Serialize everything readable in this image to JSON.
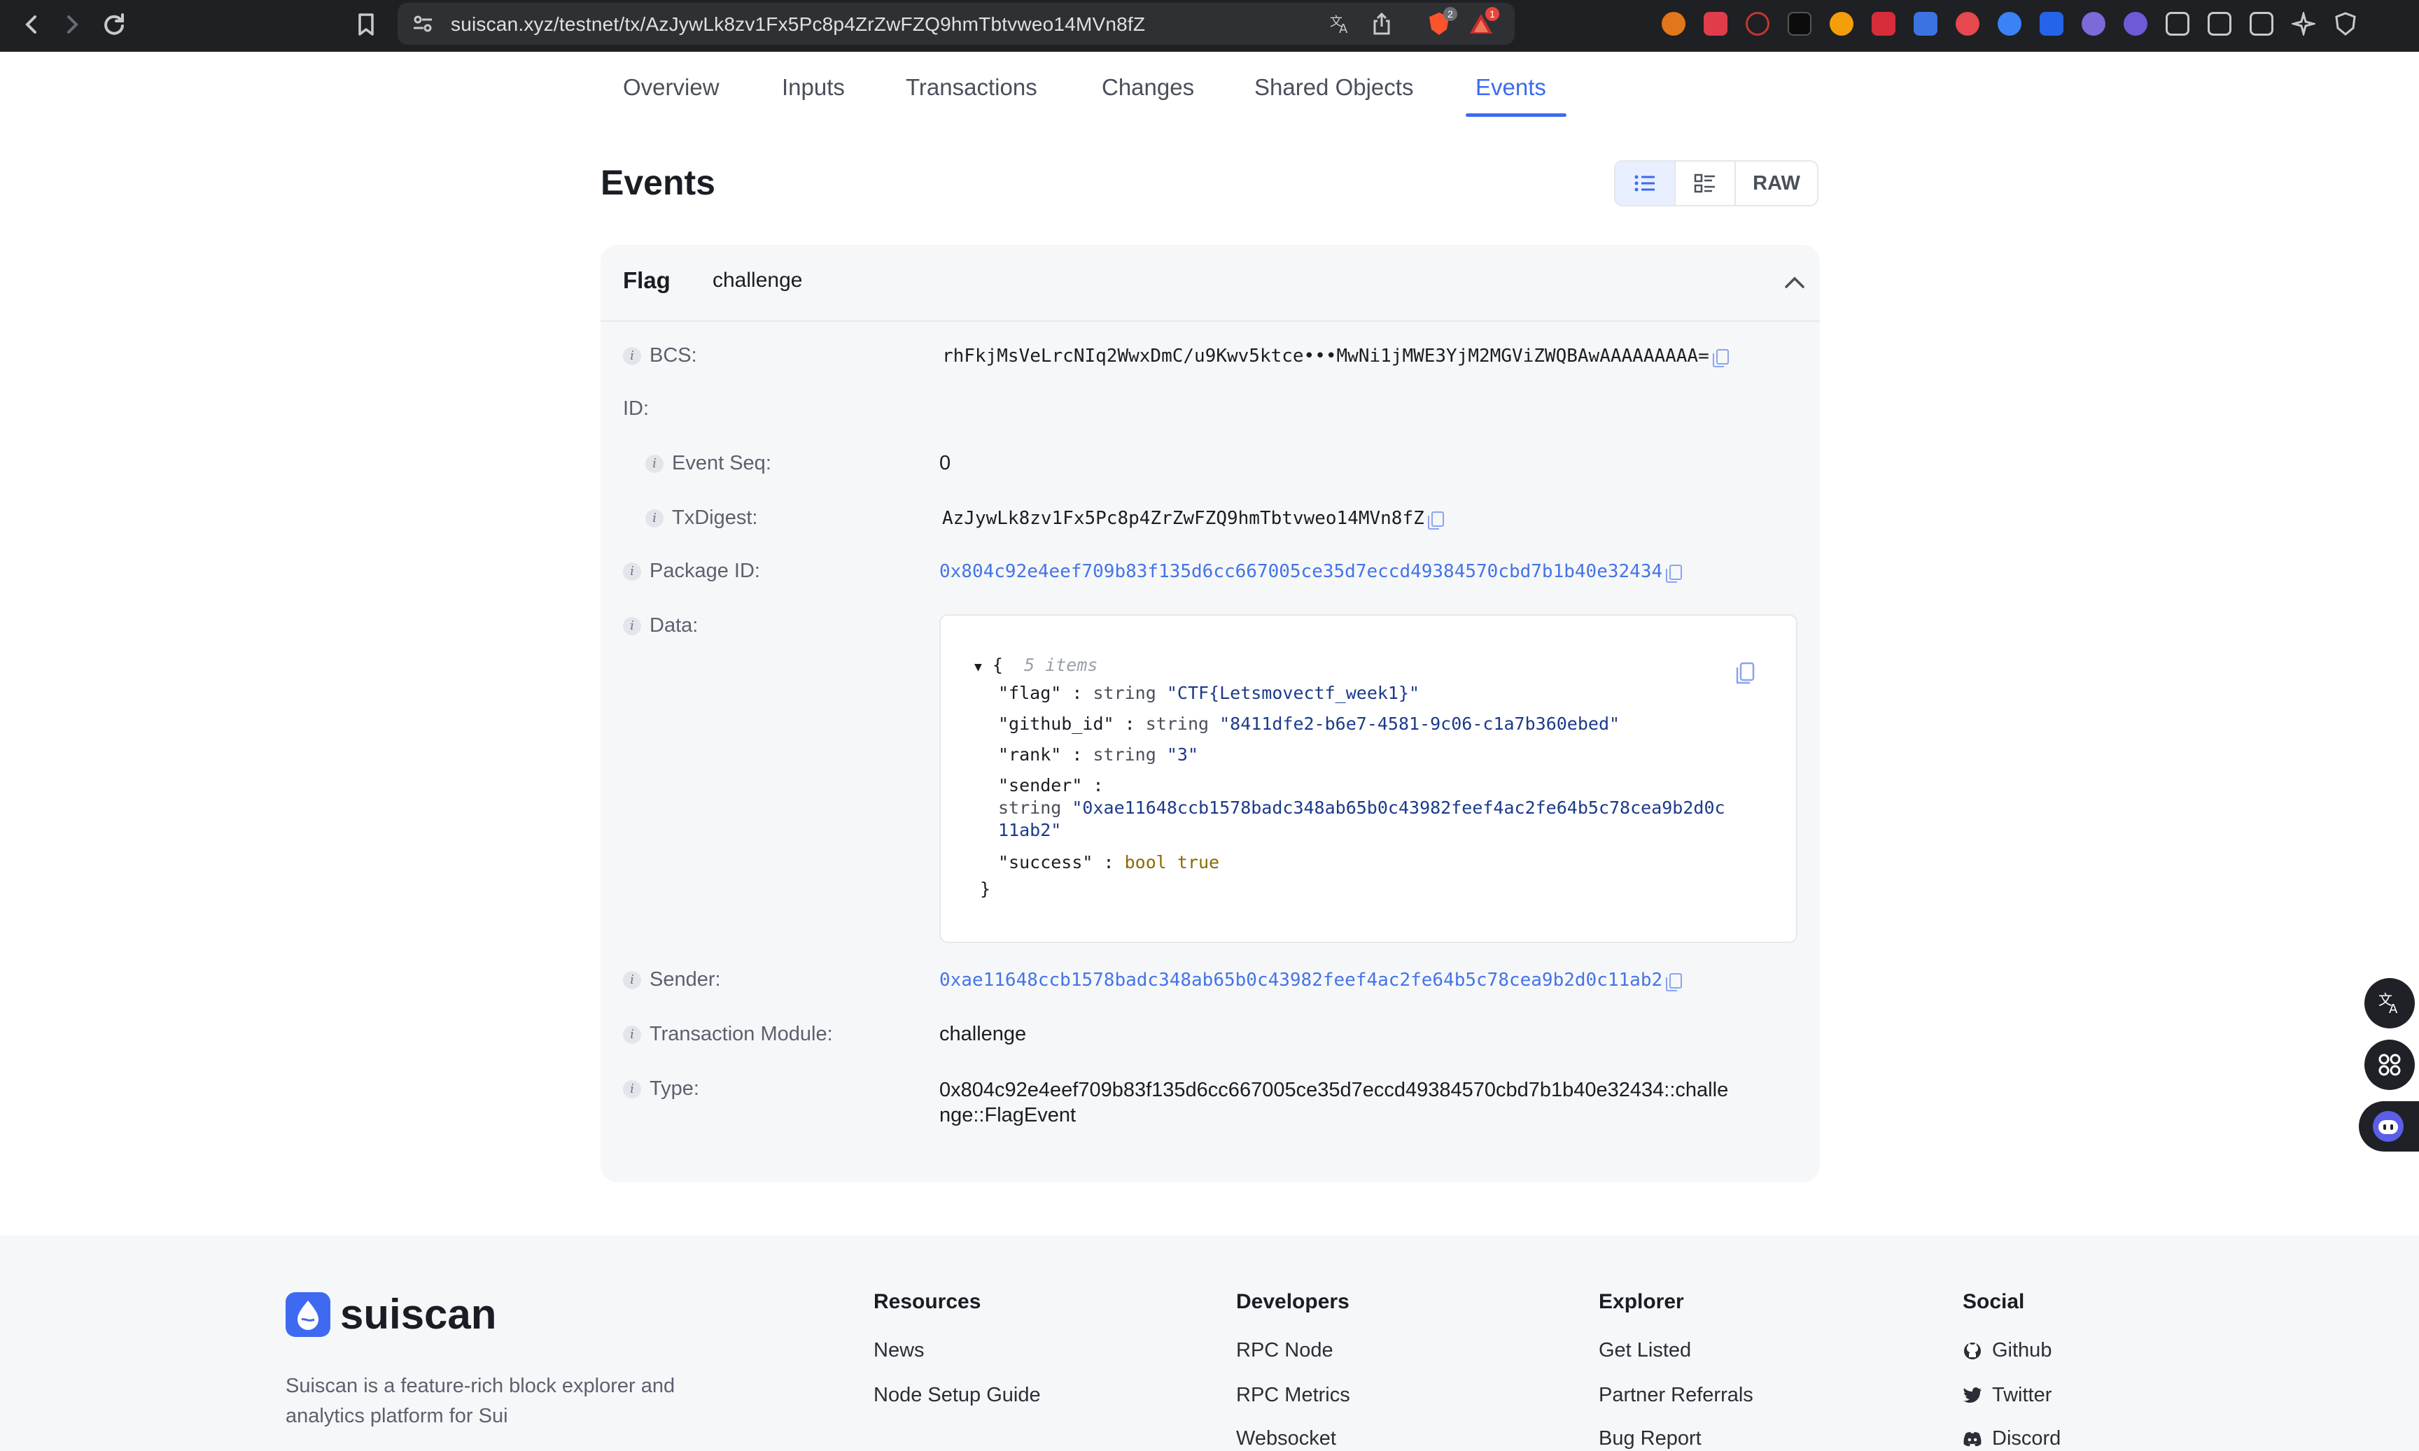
{
  "browser": {
    "url": "suiscan.xyz/testnet/tx/AzJywLk8zv1Fx5Pc8p4ZrZwFZQ9hmTbtvweo14MVn8fZ",
    "brave_badge": "2",
    "alert_badge": "1"
  },
  "tabs": [
    {
      "label": "Overview"
    },
    {
      "label": "Inputs"
    },
    {
      "label": "Transactions"
    },
    {
      "label": "Changes"
    },
    {
      "label": "Shared Objects"
    },
    {
      "label": "Events"
    }
  ],
  "active_tab": "Events",
  "page": {
    "title": "Events",
    "view_raw_label": "RAW"
  },
  "event": {
    "name": "Flag",
    "module": "challenge",
    "fields": {
      "bcs_label": "BCS:",
      "bcs_value": "rhFkjMsVeLrcNIq2WwxDmC/u9Kwv5ktce•••MwNi1jMWE3YjM2MGViZWQBAwAAAAAAAAA=",
      "id_label": "ID:",
      "event_seq_label": "Event Seq:",
      "event_seq_value": "0",
      "tx_digest_label": "TxDigest:",
      "tx_digest_value": "AzJywLk8zv1Fx5Pc8p4ZrZwFZQ9hmTbtvweo14MVn8fZ",
      "package_id_label": "Package ID:",
      "package_id_value": "0x804c92e4eef709b83f135d6cc667005ce35d7eccd49384570cbd7b1b40e32434",
      "data_label": "Data:",
      "sender_label": "Sender:",
      "sender_value": "0xae11648ccb1578badc348ab65b0c43982feef4ac2fe64b5c78cea9b2d0c11ab2",
      "tx_module_label": "Transaction Module:",
      "tx_module_value": "challenge",
      "type_label": "Type:",
      "type_value_line1": "0x804c92e4eef709b83f135d6cc667005ce35d7eccd49384570cbd7b1b40e32434::challe",
      "type_value_line2": "nge::FlagEvent"
    },
    "data_json": {
      "open": "{",
      "count": "5 items",
      "close": "}",
      "flag_key": "\"flag\"",
      "flag_type": "string",
      "flag_val": "\"CTF{Letsmovectf_week1}\"",
      "github_key": "\"github_id\"",
      "github_type": "string",
      "github_val": "\"8411dfe2-b6e7-4581-9c06-c1a7b360ebed\"",
      "rank_key": "\"rank\"",
      "rank_type": "string",
      "rank_val": "\"3\"",
      "sender_key": "\"sender\"",
      "sender_type": "string",
      "sender_val_line1": "\"0xae11648ccb1578badc348ab65b0c43982feef4ac2fe64b5c78cea9b2d0c",
      "sender_val_line2": "11ab2\"",
      "success_key": "\"success\"",
      "success_type": "bool",
      "success_val": "true"
    }
  },
  "footer": {
    "brand": "suiscan",
    "tagline": "Suiscan is a feature-rich block explorer and analytics platform for Sui",
    "columns": [
      {
        "title": "Resources",
        "items": [
          "News",
          "Node Setup Guide"
        ]
      },
      {
        "title": "Developers",
        "items": [
          "RPC Node",
          "RPC Metrics",
          "Websocket"
        ]
      },
      {
        "title": "Explorer",
        "items": [
          "Get Listed",
          "Partner Referrals",
          "Bug Report"
        ]
      },
      {
        "title": "Social",
        "items": [
          "Github",
          "Twitter",
          "Discord"
        ]
      }
    ]
  },
  "colors": {
    "accent": "#3d6af0",
    "link": "#4474e8",
    "chrome_bg": "#1f2023"
  },
  "icons": {
    "list_view": "list-view-icon",
    "detail_view": "detail-view-icon",
    "collapse": "chevron-up-icon",
    "info": "info-icon",
    "copy": "copy-icon"
  }
}
